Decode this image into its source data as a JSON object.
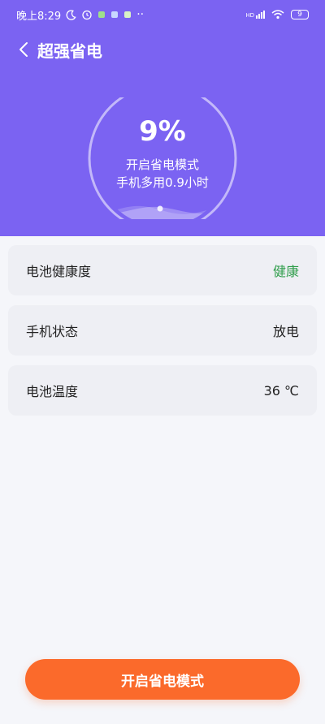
{
  "status_bar": {
    "time": "晚上8:29",
    "icons": [
      "moon-icon",
      "alarm-icon",
      "app-notification-icon",
      "app-notification-icon",
      "app-notification-icon",
      "more-icon"
    ],
    "network": "HD",
    "battery": "9"
  },
  "header": {
    "title": "超强省电",
    "back_icon": "chevron-left-icon",
    "background": "#7b63f2"
  },
  "gauge": {
    "percent_text": "9%",
    "battery_level": 0.09,
    "mode_text": "开启省电模式",
    "extra_text": "手机多用0.9小时"
  },
  "info_rows": [
    {
      "label": "电池健康度",
      "value": "健康"
    },
    {
      "label": "手机状态",
      "value": "放电"
    },
    {
      "label": "电池温度",
      "value": "36 ℃"
    }
  ],
  "cta": {
    "label": "开启省电模式",
    "color": "#fb6a2b"
  }
}
